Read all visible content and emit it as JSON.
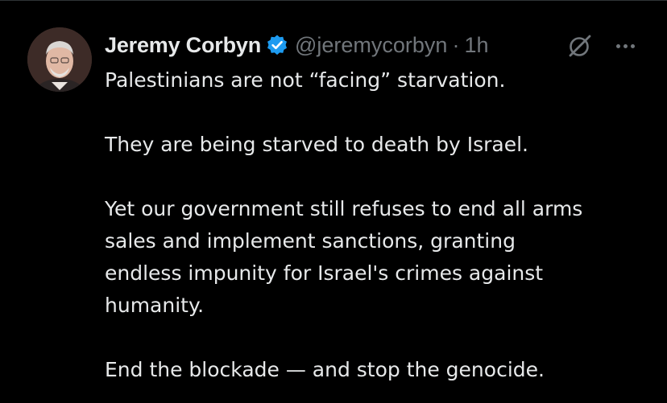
{
  "tweet": {
    "author": {
      "display_name": "Jeremy Corbyn",
      "handle": "@jeremycorbyn",
      "separator": "·",
      "time": "1h",
      "verified": true
    },
    "icons": {
      "verified": "verified-badge-icon",
      "grok": "grok-icon",
      "more": "more-options-icon"
    },
    "paragraphs": [
      "Palestinians are not “facing” starvation.",
      "They are being starved to death by Israel.",
      "Yet our government still refuses to end all arms",
      "sales and implement sanctions, granting",
      "endless impunity for Israel's crimes against",
      "humanity.",
      "End the blockade — and stop the genocide."
    ]
  },
  "colors": {
    "background": "#000000",
    "text": "#e7e9ea",
    "secondary": "#71767b",
    "verified": "#1d9bf0"
  }
}
